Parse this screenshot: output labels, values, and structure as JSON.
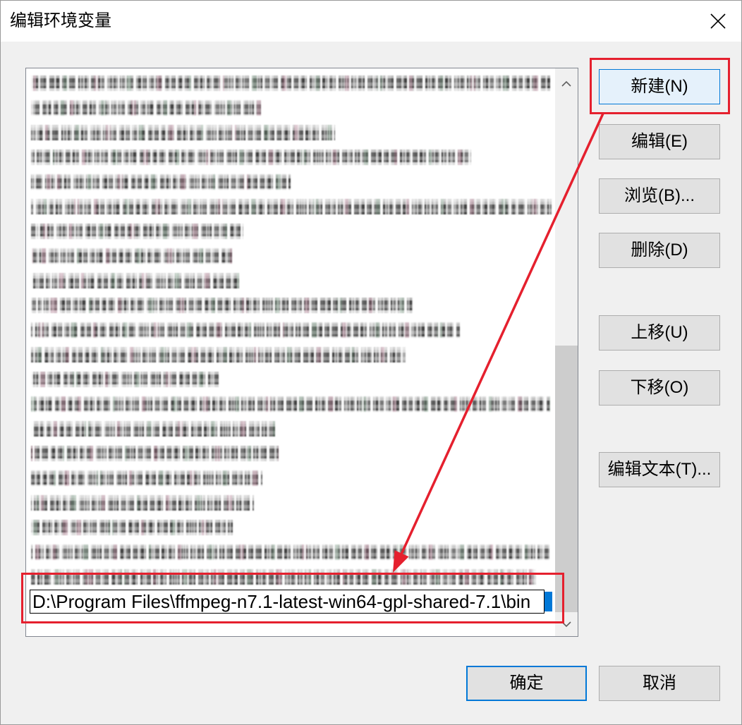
{
  "window": {
    "title": "编辑环境变量"
  },
  "icons": {
    "close": "close-icon",
    "scroll_up": "chevron-up-icon",
    "scroll_down": "chevron-down-icon",
    "annotation_arrow": "arrow-icon"
  },
  "colors": {
    "accent": "#0078d7",
    "annotation": "#e5202e",
    "dialog_background": "#f0f0f0",
    "button_face": "#e1e1e1",
    "focused_button": "#e5f1fb"
  },
  "list": {
    "editing_value": "D:\\Program Files\\ffmpeg-n7.1-latest-win64-gpl-shared-7.1\\bin",
    "scroll_position_percent": 100
  },
  "side_buttons": {
    "new": "新建(N)",
    "edit": "编辑(E)",
    "browse": "浏览(B)...",
    "delete": "删除(D)",
    "move_up": "上移(U)",
    "move_down": "下移(O)",
    "edit_text": "编辑文本(T)..."
  },
  "footer_buttons": {
    "ok": "确定",
    "cancel": "取消"
  }
}
